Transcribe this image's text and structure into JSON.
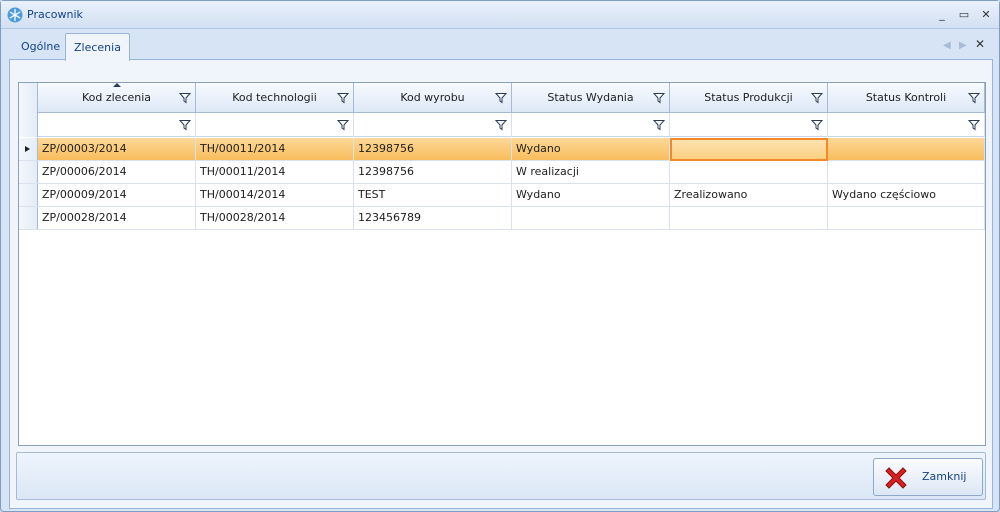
{
  "window": {
    "title": "Pracownik",
    "controls": {
      "minimize": "_",
      "maximize": "▭",
      "close": "✕"
    }
  },
  "tabs": [
    {
      "label": "Ogólne",
      "active": false
    },
    {
      "label": "Zlecenia",
      "active": true
    }
  ],
  "tab_nav": {
    "prev": "◀",
    "next": "▶",
    "close": "✕"
  },
  "grid": {
    "columns": [
      {
        "label": "Kod zlecenia",
        "sorted": "ascending"
      },
      {
        "label": "Kod technologii"
      },
      {
        "label": "Kod wyrobu"
      },
      {
        "label": "Status Wydania"
      },
      {
        "label": "Status Produkcji"
      },
      {
        "label": "Status Kontroli"
      }
    ],
    "rows": [
      {
        "selected": true,
        "cells": [
          "ZP/00003/2014",
          "TH/00011/2014",
          "12398756",
          "Wydano",
          "",
          ""
        ]
      },
      {
        "selected": false,
        "cells": [
          "ZP/00006/2014",
          "TH/00011/2014",
          "12398756",
          "W realizacji",
          "",
          ""
        ]
      },
      {
        "selected": false,
        "cells": [
          "ZP/00009/2014",
          "TH/00014/2014",
          "TEST",
          "Wydano",
          "Zrealizowano",
          "Wydano częściowo"
        ]
      },
      {
        "selected": false,
        "cells": [
          "ZP/00028/2014",
          "TH/00028/2014",
          "123456789",
          "",
          "",
          ""
        ]
      }
    ]
  },
  "footer": {
    "close_label": "Zamknij"
  },
  "colors": {
    "selection": "#f8bd5c",
    "focus_border": "#f28a2a",
    "close_icon": "#d92020",
    "title_text": "#15428b"
  }
}
